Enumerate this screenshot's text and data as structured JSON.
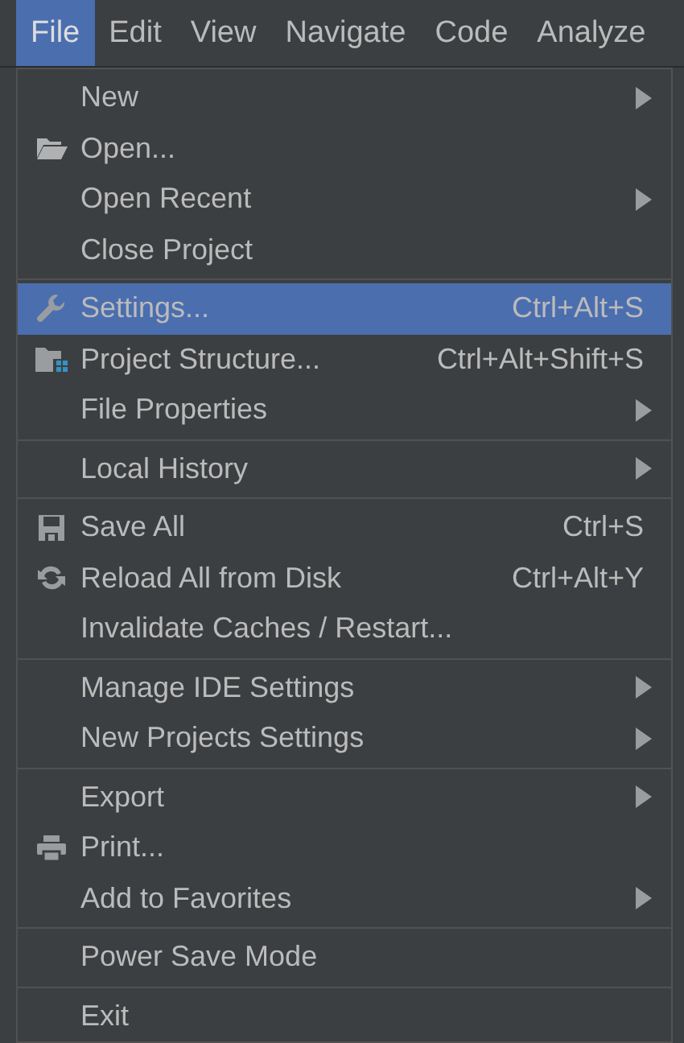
{
  "menubar": [
    {
      "label": "File",
      "selected": true
    },
    {
      "label": "Edit",
      "selected": false
    },
    {
      "label": "View",
      "selected": false
    },
    {
      "label": "Navigate",
      "selected": false
    },
    {
      "label": "Code",
      "selected": false
    },
    {
      "label": "Analyze",
      "selected": false
    }
  ],
  "file_menu": {
    "groups": [
      {
        "items": [
          {
            "label": "New",
            "submenu": true,
            "selected": false
          },
          {
            "label": "Open...",
            "kind": "folder",
            "submenu": false,
            "selected": false
          },
          {
            "label": "Open Recent",
            "submenu": true,
            "selected": false
          },
          {
            "label": "Close Project",
            "submenu": false,
            "selected": false
          }
        ]
      },
      {
        "items": [
          {
            "label": "Settings...",
            "kind": "wrench",
            "shortcut": "Ctrl+Alt+S",
            "submenu": false,
            "selected": true
          },
          {
            "label": "Project Structure...",
            "kind": "project",
            "shortcut": "Ctrl+Alt+Shift+S",
            "submenu": false,
            "selected": false
          },
          {
            "label": "File Properties",
            "submenu": true,
            "selected": false
          }
        ]
      },
      {
        "items": [
          {
            "label": "Local History",
            "submenu": true,
            "selected": false
          }
        ]
      },
      {
        "items": [
          {
            "label": "Save All",
            "kind": "save",
            "shortcut": "Ctrl+S",
            "submenu": false,
            "selected": false
          },
          {
            "label": "Reload All from Disk",
            "kind": "reload",
            "shortcut": "Ctrl+Alt+Y",
            "submenu": false,
            "selected": false
          },
          {
            "label": "Invalidate Caches / Restart...",
            "submenu": false,
            "selected": false
          }
        ]
      },
      {
        "items": [
          {
            "label": "Manage IDE Settings",
            "submenu": true,
            "selected": false
          },
          {
            "label": "New Projects Settings",
            "submenu": true,
            "selected": false
          }
        ]
      },
      {
        "items": [
          {
            "label": "Export",
            "submenu": true,
            "selected": false
          },
          {
            "label": "Print...",
            "kind": "print",
            "submenu": false,
            "selected": false
          },
          {
            "label": "Add to Favorites",
            "submenu": true,
            "selected": false
          }
        ]
      },
      {
        "items": [
          {
            "label": "Power Save Mode",
            "submenu": false,
            "selected": false
          }
        ]
      },
      {
        "items": [
          {
            "label": "Exit",
            "submenu": false,
            "selected": false
          }
        ]
      }
    ]
  }
}
